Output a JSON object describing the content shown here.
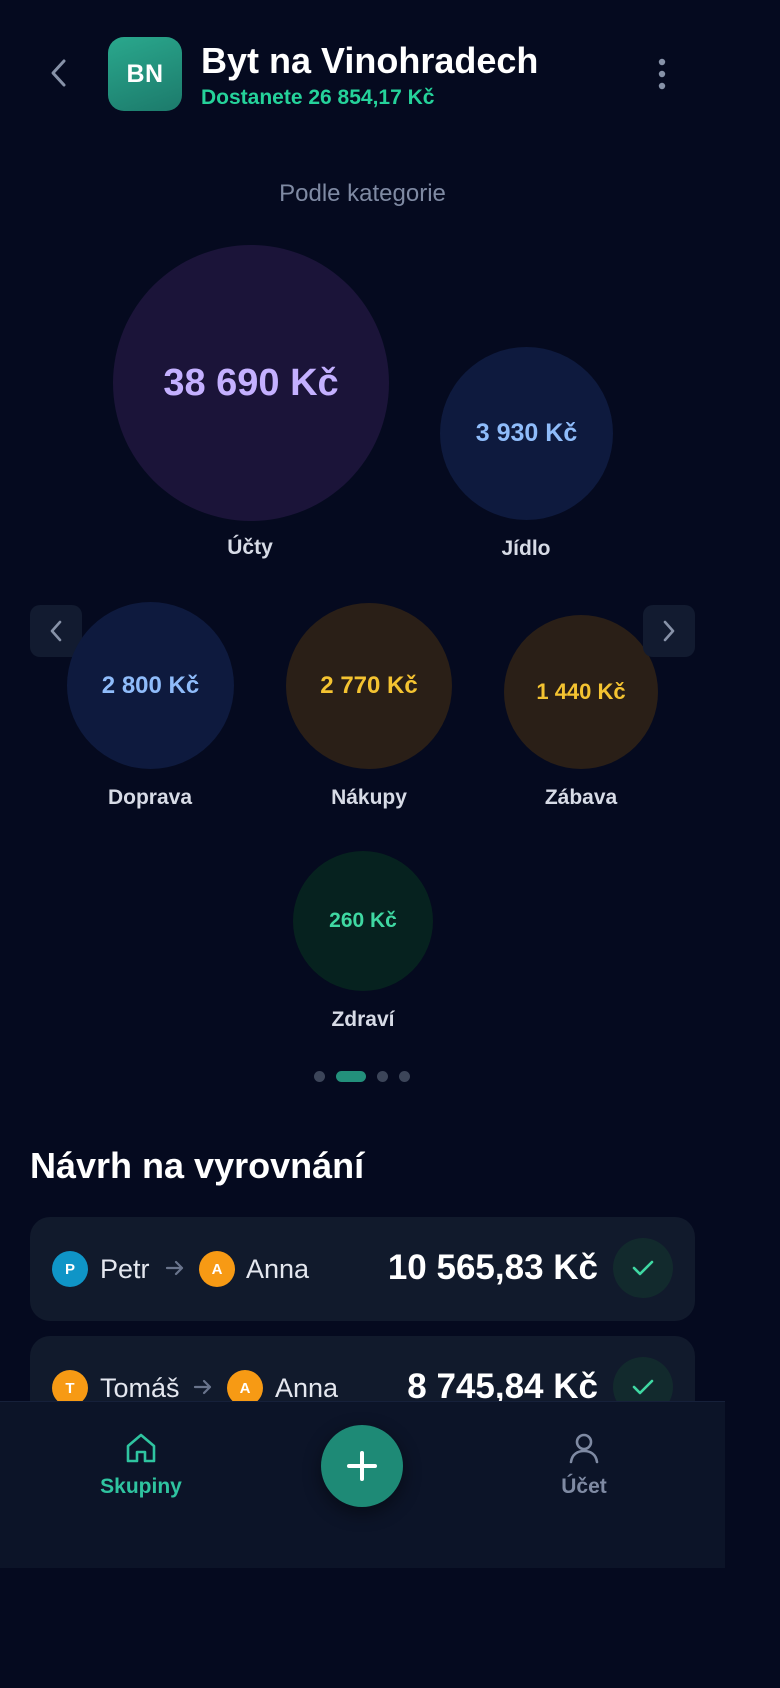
{
  "header": {
    "avatar_initials": "BN",
    "title": "Byt na Vinohradech",
    "balance": "Dostanete 26 854,17 Kč",
    "balance_color": "#25d29a"
  },
  "categories": {
    "section_label": "Podle kategorie",
    "items": [
      {
        "label": "Účty",
        "amount": "38 690 Kč",
        "color": "#c4b0ff"
      },
      {
        "label": "Jídlo",
        "amount": "3 930 Kč",
        "color": "#8fbcfa"
      },
      {
        "label": "Doprava",
        "amount": "2 800 Kč",
        "color": "#8fbcfa"
      },
      {
        "label": "Nákupy",
        "amount": "2 770 Kč",
        "color": "#f4c331"
      },
      {
        "label": "Zábava",
        "amount": "1 440 Kč",
        "color": "#f4c331"
      },
      {
        "label": "Zdraví",
        "amount": "260 Kč",
        "color": "#3fd8a2"
      }
    ],
    "pager": {
      "page_count": 4,
      "active_index": 1
    }
  },
  "settlement": {
    "title": "Návrh na vyrovnání",
    "items": [
      {
        "from": "Petr",
        "from_initial": "P",
        "to": "Anna",
        "to_initial": "A",
        "amount": "10 565,83 Kč"
      },
      {
        "from": "Tomáš",
        "from_initial": "T",
        "to": "Anna",
        "to_initial": "A",
        "amount": "8 745,84 Kč"
      }
    ]
  },
  "bottom_nav": {
    "groups_label": "Skupiny",
    "account_label": "Účet",
    "accent_color": "#2fc4a0"
  },
  "icons": [
    "chevron-left-icon",
    "more-vertical-icon",
    "chevron-right-icon",
    "arrow-right-icon",
    "check-icon",
    "home-icon",
    "plus-icon",
    "user-icon"
  ]
}
